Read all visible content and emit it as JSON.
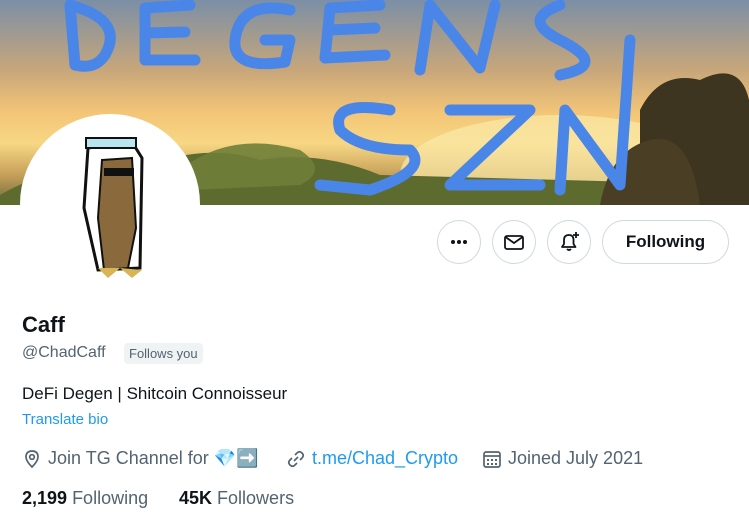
{
  "banner": {
    "text_line1": "DEGEN",
    "text_line2": "SZN"
  },
  "profile": {
    "name": "Caff",
    "handle": "@ChadCaff",
    "follows_you": "Follows you",
    "bio": "DeFi Degen | Shitcoin Connoisseur",
    "translate_bio": "Translate bio",
    "location": "Join TG Channel for",
    "location_emojis": "💎➡️",
    "url": "t.me/Chad_Crypto",
    "joined": "Joined July 2021"
  },
  "actions": {
    "following_label": "Following"
  },
  "stats": {
    "following_count": "2,199",
    "following_label": "Following",
    "followers_count": "45K",
    "followers_label": "Followers"
  },
  "colors": {
    "accent": "#1d9bf0",
    "banner_text": "#4a86e8"
  },
  "icons": [
    "more-icon",
    "mail-icon",
    "bell-plus-icon",
    "location-icon",
    "link-icon",
    "calendar-icon"
  ]
}
